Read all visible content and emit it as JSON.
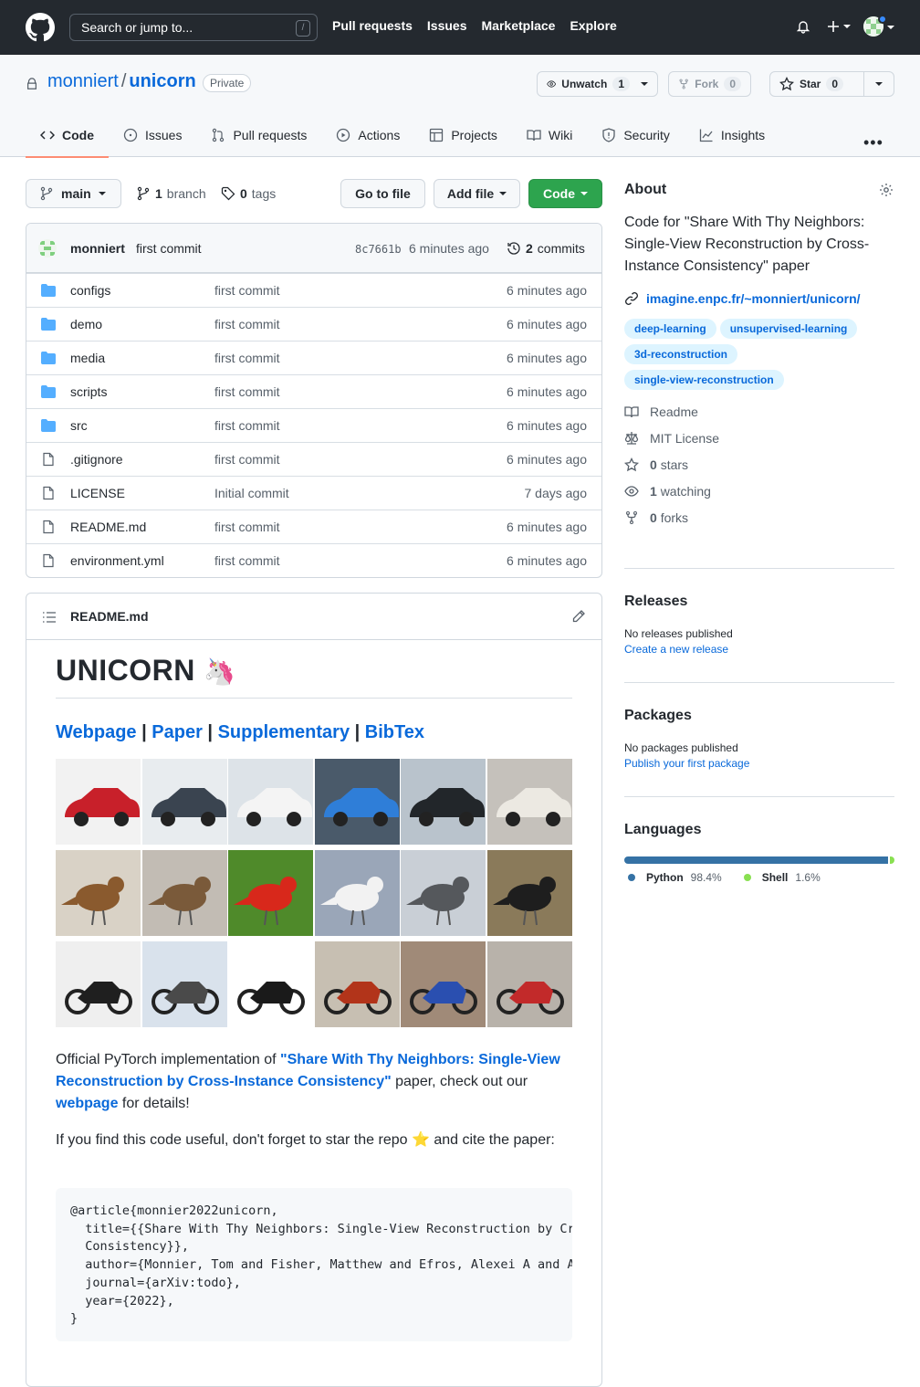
{
  "header": {
    "search_placeholder": "Search or jump to...",
    "search_hint": "/",
    "nav": [
      "Pull requests",
      "Issues",
      "Marketplace",
      "Explore"
    ]
  },
  "repo": {
    "owner": "monniert",
    "separator": "/",
    "name": "unicorn",
    "visibility": "Private",
    "unwatch_label": "Unwatch",
    "watch_count": "1",
    "fork_label": "Fork",
    "fork_count": "0",
    "star_label": "Star",
    "star_count": "0"
  },
  "tabs": [
    {
      "label": "Code",
      "icon": "code-icon"
    },
    {
      "label": "Issues",
      "icon": "issue-icon"
    },
    {
      "label": "Pull requests",
      "icon": "pull-request-icon"
    },
    {
      "label": "Actions",
      "icon": "play-icon"
    },
    {
      "label": "Projects",
      "icon": "table-icon"
    },
    {
      "label": "Wiki",
      "icon": "book-icon"
    },
    {
      "label": "Security",
      "icon": "shield-icon"
    },
    {
      "label": "Insights",
      "icon": "graph-icon"
    }
  ],
  "toolbar": {
    "branch": "main",
    "branch_count": "1",
    "branch_word": "branch",
    "tag_count": "0",
    "tag_word": "tags",
    "go_to_file": "Go to file",
    "add_file": "Add file",
    "code": "Code"
  },
  "latest_commit": {
    "author": "monniert",
    "message": "first commit",
    "sha": "8c7661b",
    "time": "6 minutes ago",
    "commit_count": "2",
    "commit_word": "commits"
  },
  "files": [
    {
      "name": "configs",
      "type": "dir",
      "message": "first commit",
      "time": "6 minutes ago"
    },
    {
      "name": "demo",
      "type": "dir",
      "message": "first commit",
      "time": "6 minutes ago"
    },
    {
      "name": "media",
      "type": "dir",
      "message": "first commit",
      "time": "6 minutes ago"
    },
    {
      "name": "scripts",
      "type": "dir",
      "message": "first commit",
      "time": "6 minutes ago"
    },
    {
      "name": "src",
      "type": "dir",
      "message": "first commit",
      "time": "6 minutes ago"
    },
    {
      "name": ".gitignore",
      "type": "file",
      "message": "first commit",
      "time": "6 minutes ago"
    },
    {
      "name": "LICENSE",
      "type": "file",
      "message": "Initial commit",
      "time": "7 days ago"
    },
    {
      "name": "README.md",
      "type": "file",
      "message": "first commit",
      "time": "6 minutes ago"
    },
    {
      "name": "environment.yml",
      "type": "file",
      "message": "first commit",
      "time": "6 minutes ago"
    }
  ],
  "readme": {
    "file_name": "README.md",
    "title": "UNICORN",
    "title_emoji": "🦄",
    "links": [
      "Webpage",
      "Paper",
      "Supplementary",
      "BibTex"
    ],
    "link_sep": " | ",
    "p1_a": "Official PyTorch implementation of ",
    "p1_link": "\"Share With Thy Neighbors: Single-View Reconstruction by Cross-Instance Consistency\"",
    "p1_b": " paper, check out our ",
    "p1_link2": "webpage",
    "p1_c": " for details!",
    "p2_a": "If you find this code useful, don't forget to star the repo ",
    "p2_emoji": "⭐",
    "p2_b": " and cite the paper:",
    "bibtex": "@article{monnier2022unicorn,\n  title={{Share With Thy Neighbors: Single-View Reconstruction by Cross-Instance\n  Consistency}},\n  author={Monnier, Tom and Fisher, Matthew and Efros, Alexei A and Aubry, Mathieu},\n  journal={arXiv:todo},\n  year={2022},\n}",
    "image_rows": [
      [
        "red car",
        "dark hatchback",
        "white sedan",
        "blue car",
        "black sedan",
        "white van"
      ],
      [
        "brown bird",
        "grebe",
        "red tanager",
        "gull",
        "grey bird",
        "black bird"
      ],
      [
        "scooter",
        "touring motorcycle",
        "black motorcycle",
        "cruiser",
        "blue chopper",
        "red sport bike"
      ]
    ]
  },
  "about": {
    "heading": "About",
    "description": "Code for \"Share With Thy Neighbors: Single-View Reconstruction by Cross-Instance Consistency\" paper",
    "website": "imagine.enpc.fr/~monniert/unicorn/",
    "topics": [
      "deep-learning",
      "unsupervised-learning",
      "3d-reconstruction",
      "single-view-reconstruction"
    ],
    "readme": "Readme",
    "license": "MIT License",
    "stars_count": "0",
    "stars_word": "stars",
    "watching_count": "1",
    "watching_word": "watching",
    "forks_count": "0",
    "forks_word": "forks"
  },
  "releases": {
    "heading": "Releases",
    "empty": "No releases published",
    "link": "Create a new release"
  },
  "packages": {
    "heading": "Packages",
    "empty": "No packages published",
    "link": "Publish your first package"
  },
  "languages": {
    "heading": "Languages",
    "items": [
      {
        "name": "Python",
        "percent": "98.4%",
        "value": 98.4,
        "color": "#3572A5"
      },
      {
        "name": "Shell",
        "percent": "1.6%",
        "value": 1.6,
        "color": "#89e051"
      }
    ]
  },
  "colors": {
    "accent": "#0969da",
    "green": "#2da44e",
    "header": "#24292f",
    "tab_underline": "#fd8c73"
  }
}
